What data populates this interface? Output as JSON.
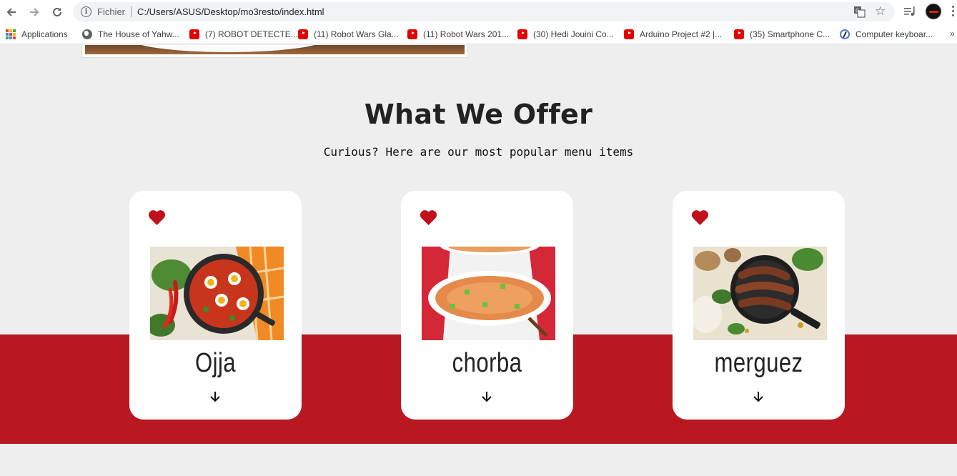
{
  "browser": {
    "scheme_label": "Fichier",
    "url": "C:/Users/ASUS/Desktop/mo3resto/index.html",
    "bookmarks": [
      {
        "label": "Applications",
        "icon": "apps-grid-icon"
      },
      {
        "label": "The House of Yahw...",
        "icon": "globe-icon"
      },
      {
        "label": "(7) ROBOT DETECTE...",
        "icon": "youtube-icon"
      },
      {
        "label": "(11) Robot Wars Gla...",
        "icon": "youtube-icon"
      },
      {
        "label": "(11) Robot Wars 201...",
        "icon": "youtube-icon"
      },
      {
        "label": "(30) Hedi Jouini Co...",
        "icon": "youtube-icon"
      },
      {
        "label": "Arduino Project #2 |...",
        "icon": "youtube-icon"
      },
      {
        "label": "(35) Smartphone C...",
        "icon": "youtube-icon"
      },
      {
        "label": "Computer keyboar...",
        "icon": "keyboard-site-icon"
      }
    ],
    "more_bookmarks": "»"
  },
  "offer": {
    "title": "What We Offer",
    "subtitle": "Curious? Here are our most popular menu items",
    "items": [
      {
        "name": "Ojja"
      },
      {
        "name": "chorba"
      },
      {
        "name": "merguez"
      }
    ]
  },
  "colors": {
    "accent_red": "#b91822",
    "heart_red": "#c0101c",
    "page_bg": "#eeeeee",
    "card_bg": "#ffffff"
  }
}
